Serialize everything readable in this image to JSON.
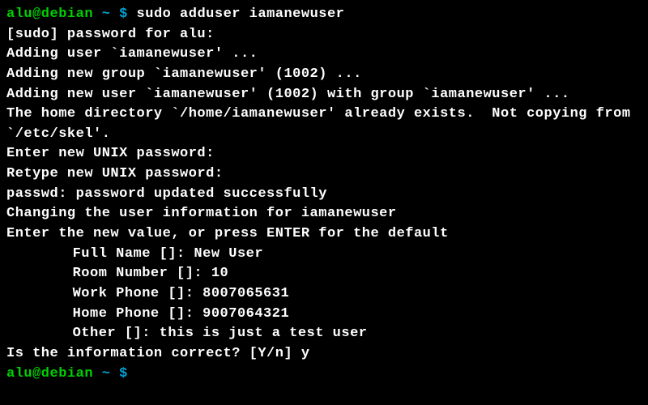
{
  "prompt1": {
    "user_host": "alu@debian",
    "separator": " ~ $ ",
    "command": "sudo adduser iamanewuser"
  },
  "output": {
    "sudo_password": "[sudo] password for alu:",
    "adding_user": "Adding user `iamanewuser' ...",
    "adding_group": "Adding new group `iamanewuser' (1002) ...",
    "adding_new_user": "Adding new user `iamanewuser' (1002) with group `iamanewuser' ...",
    "home_dir": "The home directory `/home/iamanewuser' already exists.  Not copying from `/etc/skel'.",
    "enter_pw": "Enter new UNIX password:",
    "retype_pw": "Retype new UNIX password:",
    "passwd_success": "passwd: password updated successfully",
    "changing_info": "Changing the user information for iamanewuser",
    "enter_value": "Enter the new value, or press ENTER for the default",
    "full_name": "Full Name []: New User",
    "room_number": "Room Number []: 10",
    "work_phone": "Work Phone []: 8007065631",
    "home_phone": "Home Phone []: 9007064321",
    "other": "Other []: this is just a test user",
    "confirm": "Is the information correct? [Y/n] y"
  },
  "prompt2": {
    "user_host": "alu@debian",
    "separator": " ~ $ "
  }
}
